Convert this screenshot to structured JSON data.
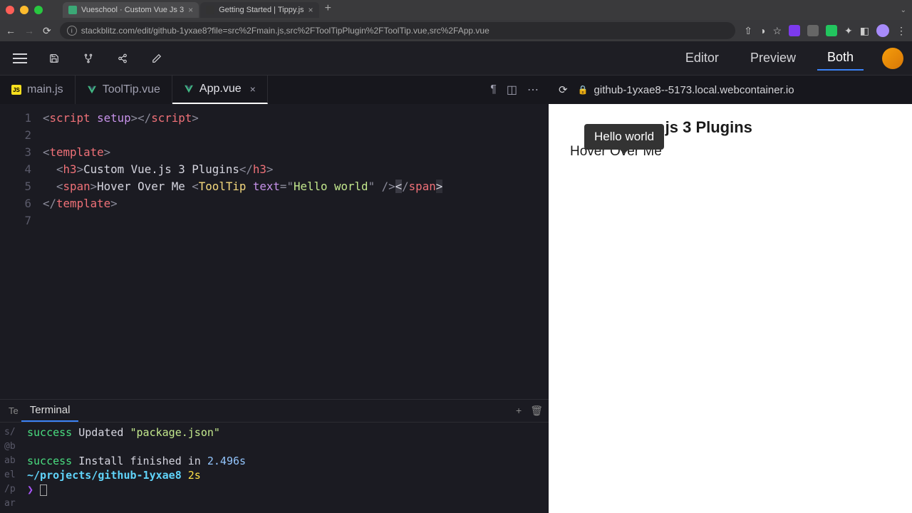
{
  "browser": {
    "tabs": [
      {
        "title": "Vueschool · Custom Vue Js 3",
        "active": true
      },
      {
        "title": "Getting Started | Tippy.js",
        "active": false
      }
    ],
    "url": "stackblitz.com/edit/github-1yxae8?file=src%2Fmain.js,src%2FToolTipPlugin%2FToolTip.vue,src%2FApp.vue"
  },
  "stackblitz": {
    "views": {
      "editor": "Editor",
      "preview": "Preview",
      "both": "Both",
      "active": "Both"
    }
  },
  "editor": {
    "tabs": [
      {
        "name": "main.js",
        "type": "js",
        "active": false
      },
      {
        "name": "ToolTip.vue",
        "type": "vue",
        "active": false
      },
      {
        "name": "App.vue",
        "type": "vue",
        "active": true
      }
    ],
    "lines": [
      "1",
      "2",
      "3",
      "4",
      "5",
      "6",
      "7"
    ]
  },
  "code": {
    "script_open": "<",
    "script_tag": "script",
    "setup_attr": "setup",
    "script_close": "></",
    "script_tag2": "script",
    "script_end": ">",
    "tpl_open": "<",
    "tpl_tag": "template",
    "tpl_close": ">",
    "h3_open": "<",
    "h3_tag": "h3",
    "h3_close": ">",
    "h3_text": "Custom Vue.js 3 Plugins",
    "h3_end_open": "</",
    "h3_end": ">",
    "span_open": "<",
    "span_tag": "span",
    "span_close": ">",
    "span_text": "Hover Over Me ",
    "tt_open": "<",
    "tt_tag": "ToolTip",
    "tt_attr": "text",
    "tt_eq": "=",
    "tt_q": "\"",
    "tt_val": "Hello world",
    "tt_end": " />",
    "span_end_open": "</",
    "span_end_close": ">",
    "tpl_end_open": "</",
    "tpl_end_close": ">"
  },
  "terminal": {
    "title": "Terminal",
    "trunc_tab": "Te",
    "left_frags": [
      "s/",
      "@b",
      "ab",
      "el",
      "/p",
      "ar"
    ],
    "lines": [
      {
        "parts": [
          [
            "success",
            "success"
          ],
          [
            " ",
            ""
          ],
          [
            "Updated ",
            ""
          ],
          [
            "\"package.json\"",
            "str"
          ]
        ]
      },
      {
        "parts": [
          [
            "",
            ""
          ]
        ]
      },
      {
        "parts": [
          [
            "success",
            "success"
          ],
          [
            " ",
            ""
          ],
          [
            "Install finished in ",
            ""
          ],
          [
            "2.496s",
            "num"
          ]
        ]
      },
      {
        "parts": [
          [
            "~/projects/github-1yxae8",
            "path"
          ],
          [
            " ",
            ""
          ],
          [
            "2s",
            "time"
          ]
        ]
      },
      {
        "parts": [
          [
            "❯",
            "prompt"
          ]
        ]
      }
    ]
  },
  "preview": {
    "url": "github-1yxae8--5173.local.webcontainer.io",
    "tooltip": "Hello world",
    "heading_visible": ".js 3 Plugins",
    "hover_text": "Hover Over Me"
  }
}
